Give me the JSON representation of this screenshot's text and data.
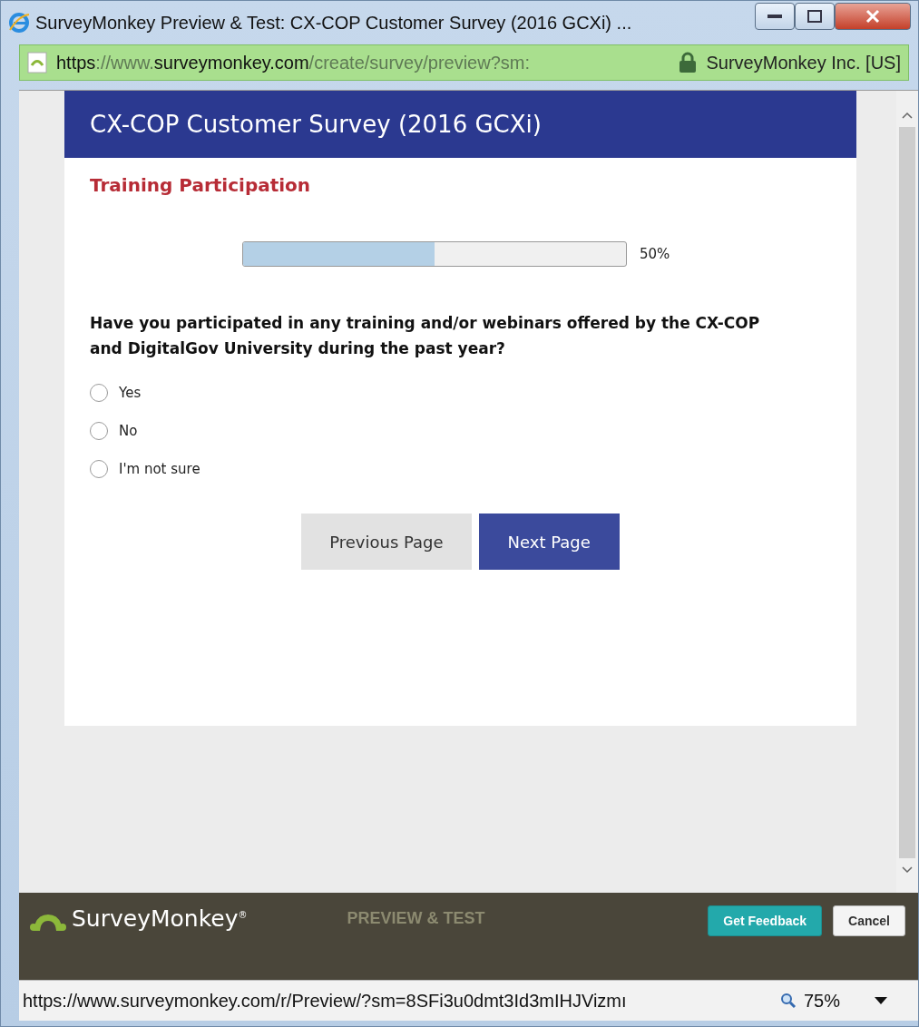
{
  "window": {
    "title": "SurveyMonkey Preview & Test: CX-COP Customer Survey (2016 GCXi) ..."
  },
  "address_bar": {
    "url_parts": [
      {
        "text": "https",
        "strong": true
      },
      {
        "text": "://www.",
        "strong": false
      },
      {
        "text": "surveymonkey.com",
        "strong": true
      },
      {
        "text": "/create/survey/preview?sm:",
        "strong": false
      }
    ],
    "site_identity": "SurveyMonkey Inc. [US]"
  },
  "survey": {
    "title": "CX-COP Customer Survey (2016 GCXi)",
    "page_title": "Training Participation",
    "progress": {
      "level": 0.5,
      "reading": "50%"
    },
    "question": "Have you participated in any training and/or webinars offered by the CX-COP and DigitalGov University during the past year?",
    "options": [
      {
        "label": "Yes",
        "selected": false
      },
      {
        "label": "No",
        "selected": false
      },
      {
        "label": "I'm not sure",
        "selected": false
      }
    ],
    "buttons": [
      {
        "label": "Previous Page",
        "kind": "secondary"
      },
      {
        "label": "Next Page",
        "kind": "primary"
      }
    ]
  },
  "footer": {
    "brand": "SurveyMonkey",
    "brand_mark": "®",
    "mode": "PREVIEW & TEST",
    "buttons": [
      {
        "label": "Get Feedback",
        "kind": "primary"
      },
      {
        "label": "Cancel",
        "kind": "secondary"
      }
    ]
  },
  "status_bar": {
    "url": "https://www.surveymonkey.com/r/Preview/?sm=8SFi3u0dmt3Id3mIHJVizmı",
    "zoom": "75%"
  }
}
